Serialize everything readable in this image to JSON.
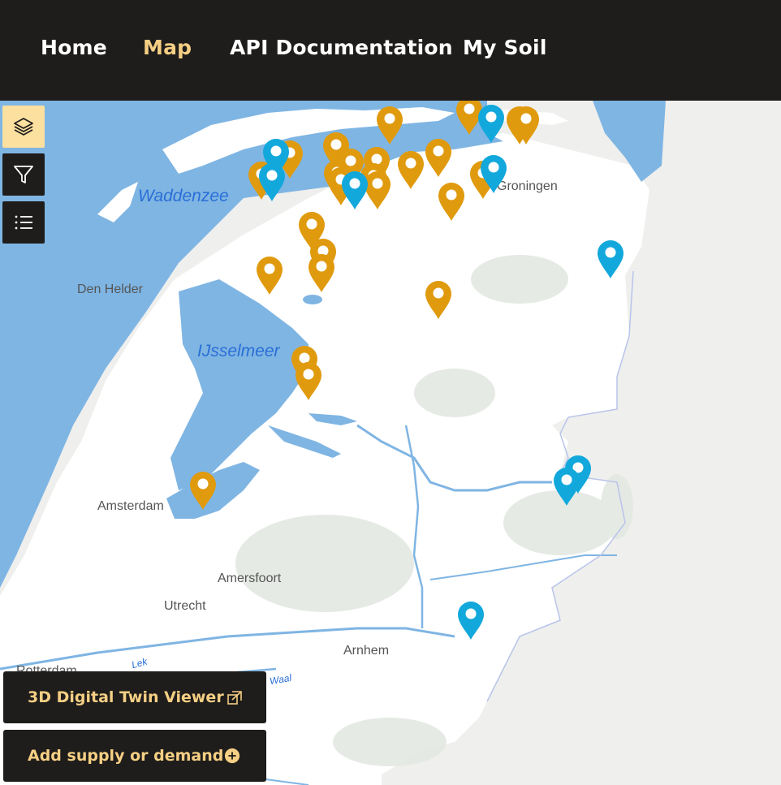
{
  "nav": {
    "items": [
      {
        "label": "Home",
        "active": false
      },
      {
        "label": "Map",
        "active": true
      },
      {
        "label": "API Documentation",
        "active": false
      },
      {
        "label": "My Soil",
        "active": false
      }
    ]
  },
  "map": {
    "controls": [
      {
        "name": "layers",
        "icon": "layers-icon",
        "active": true
      },
      {
        "name": "filter",
        "icon": "filter-icon",
        "active": false
      },
      {
        "name": "list",
        "icon": "list-icon",
        "active": false
      }
    ],
    "labels": {
      "waddenzee": "Waddenzee",
      "ijsselmeer": "IJsselmeer",
      "den_helder": "Den Helder",
      "amsterdam": "Amsterdam",
      "amersfoort": "Amersfoort",
      "utrecht": "Utrecht",
      "arnhem": "Arnhem",
      "rotterdam": "Rotterdam",
      "groningen": "Groningen",
      "lek": "Lek",
      "waal": "Waal"
    },
    "markers": {
      "supply": {
        "color": "#e09a0e",
        "icon": "map-pin-icon"
      },
      "demand": {
        "color": "#12a8dc",
        "icon": "map-pin-icon"
      }
    }
  },
  "actions": {
    "viewer_label": "3D Digital Twin Viewer",
    "viewer_icon": "external-link-icon",
    "add_label": "Add supply or demand",
    "add_icon": "plus-circle-icon"
  },
  "colors": {
    "navbar": "#1f1d1b",
    "accent": "#f5cf84",
    "water": "#7fb5e3",
    "land": "#ffffff",
    "supply_pin": "#e09a0e",
    "demand_pin": "#12a8dc"
  }
}
